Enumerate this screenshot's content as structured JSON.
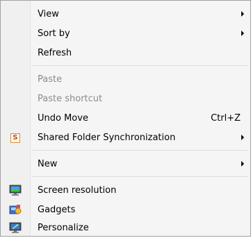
{
  "menu": {
    "items": [
      {
        "label": "View",
        "submenu": true,
        "disabled": false
      },
      {
        "label": "Sort by",
        "submenu": true,
        "disabled": false
      },
      {
        "label": "Refresh",
        "submenu": false,
        "disabled": false
      },
      {
        "label": "Paste",
        "submenu": false,
        "disabled": true
      },
      {
        "label": "Paste shortcut",
        "submenu": false,
        "disabled": true
      },
      {
        "label": "Undo Move",
        "shortcut": "Ctrl+Z",
        "submenu": false,
        "disabled": false
      },
      {
        "label": "Shared Folder Synchronization",
        "submenu": true,
        "disabled": false,
        "icon": "shared-folder-sync-icon",
        "icon_glyph": "S"
      },
      {
        "label": "New",
        "submenu": true,
        "disabled": false
      },
      {
        "label": "Screen resolution",
        "submenu": false,
        "disabled": false,
        "icon": "monitor-icon"
      },
      {
        "label": "Gadgets",
        "submenu": false,
        "disabled": false,
        "icon": "gadgets-icon"
      },
      {
        "label": "Personalize",
        "submenu": false,
        "disabled": false,
        "icon": "personalize-icon"
      }
    ]
  }
}
